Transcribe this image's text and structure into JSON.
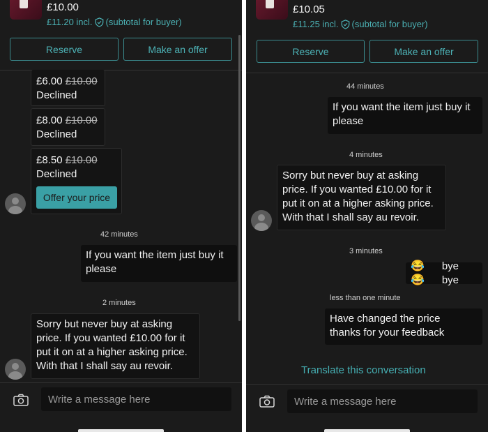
{
  "left": {
    "listing": {
      "price": "£10.00",
      "incl": "£11.20 incl.",
      "subtotal_note": "(subtotal for buyer)"
    },
    "actions": {
      "reserve": "Reserve",
      "make_offer": "Make an offer"
    },
    "offers": [
      {
        "amount": "£6.00",
        "original": "£10.00",
        "status": "Declined"
      },
      {
        "amount": "£8.00",
        "original": "£10.00",
        "status": "Declined"
      },
      {
        "amount": "£8.50",
        "original": "£10.00",
        "status": "Declined",
        "cta": "Offer your price"
      }
    ],
    "messages": [
      {
        "time": "42 minutes",
        "text_lines": [
          "If you want the item just buy it",
          "please"
        ]
      },
      {
        "time": "2 minutes",
        "text_lines": [
          "Sorry but never buy at asking",
          "price. If you wanted £10.00 for it",
          "put it on at a higher asking price.",
          "With that I shall say au revoir."
        ]
      }
    ],
    "composer": {
      "placeholder": "Write a message here"
    }
  },
  "right": {
    "listing": {
      "price": "£10.05",
      "incl": "£11.25 incl.",
      "subtotal_note": "(subtotal for buyer)"
    },
    "actions": {
      "reserve": "Reserve",
      "make_offer": "Make an offer"
    },
    "messages": [
      {
        "time": "44 minutes",
        "text_lines": [
          "If you want the item just buy it",
          "please"
        ]
      },
      {
        "time": "4 minutes",
        "text_lines": [
          "Sorry but never buy at asking",
          "price. If you wanted £10.00 for it",
          "put it on at a higher asking price.",
          "With that I shall say au revoir."
        ]
      },
      {
        "time": "3 minutes",
        "emoji": "😂😂",
        "text": "bye bye"
      },
      {
        "time": "less than one minute",
        "text_lines": [
          "Have changed the price",
          "thanks for your feedback"
        ]
      }
    ],
    "translate": "Translate this conversation",
    "composer": {
      "placeholder": "Write a message here"
    }
  },
  "colors": {
    "accent": "#45aeb2",
    "background": "#1b1b1b",
    "bubble": "#0f0f0f"
  },
  "icons": {
    "camera": "camera-icon",
    "shield": "shield-check-icon",
    "avatar": "default-avatar-icon"
  }
}
